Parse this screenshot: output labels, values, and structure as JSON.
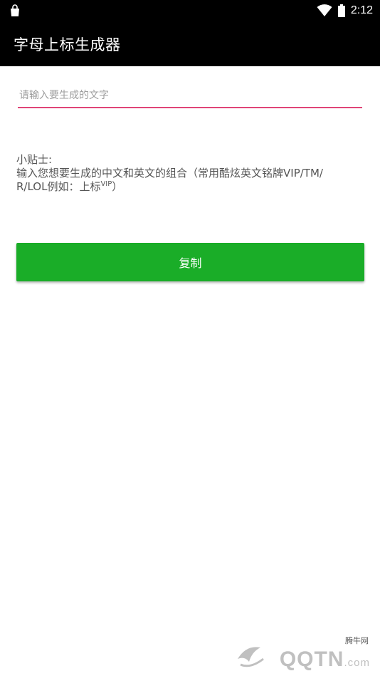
{
  "status_bar": {
    "time": "2:12",
    "left_icon": "shopping-bag-icon",
    "right_icons": [
      "wifi-icon",
      "battery-icon"
    ]
  },
  "app_bar": {
    "title": "字母上标生成器"
  },
  "input": {
    "value": "",
    "placeholder": "请输入要生成的文字",
    "underline_color": "#e04577"
  },
  "tips": {
    "heading": "小贴士:",
    "body_line1": "输入您想要生成的中文和英文的组合（常用酷炫英文铭牌VIP/TM/",
    "body_line2_prefix": "R/LOL例如：上标",
    "body_line2_sup": "VIP",
    "body_line2_suffix": "）"
  },
  "copy_button": {
    "label": "复制",
    "color": "#1aad28"
  },
  "watermark": {
    "small_text": "腾牛网",
    "main_text": "QQTN",
    "suffix": ".com"
  }
}
